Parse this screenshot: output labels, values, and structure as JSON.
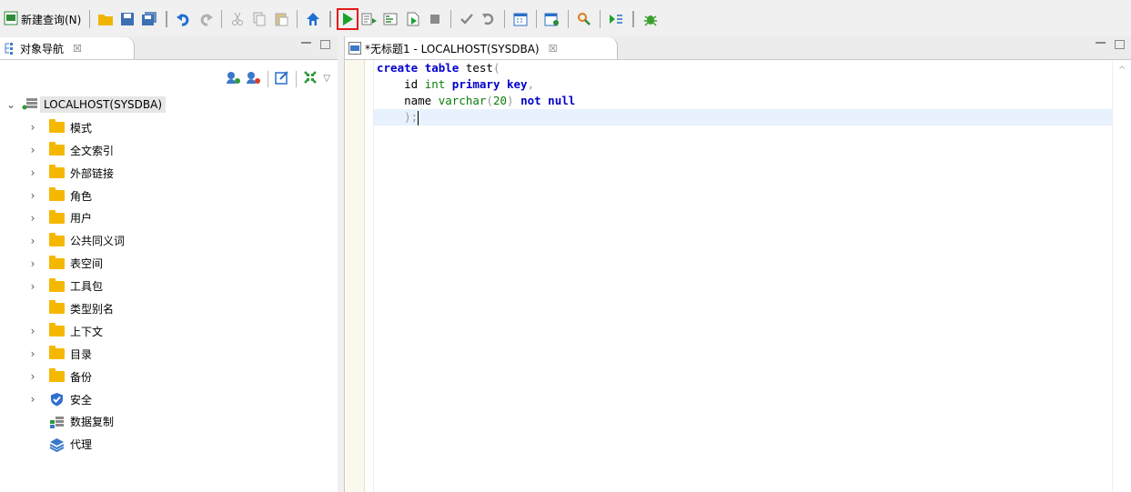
{
  "toolbar": {
    "new_query_label": "新建查询(N)"
  },
  "left_panel": {
    "tab_title": "对象导航",
    "tab_close": "☒",
    "tree": {
      "root": "LOCALHOST(SYSDBA)",
      "children": [
        {
          "label": "模式",
          "icon": "folder-icon",
          "expandable": true
        },
        {
          "label": "全文索引",
          "icon": "folder-icon",
          "expandable": true
        },
        {
          "label": "外部链接",
          "icon": "folder-icon",
          "expandable": true
        },
        {
          "label": "角色",
          "icon": "folder-icon",
          "expandable": true
        },
        {
          "label": "用户",
          "icon": "folder-icon",
          "expandable": true
        },
        {
          "label": "公共同义词",
          "icon": "folder-icon",
          "expandable": true
        },
        {
          "label": "表空间",
          "icon": "folder-icon",
          "expandable": true
        },
        {
          "label": "工具包",
          "icon": "folder-icon",
          "expandable": true
        },
        {
          "label": "类型别名",
          "icon": "folder-icon",
          "expandable": false
        },
        {
          "label": "上下文",
          "icon": "folder-icon",
          "expandable": true
        },
        {
          "label": "目录",
          "icon": "folder-icon",
          "expandable": true
        },
        {
          "label": "备份",
          "icon": "folder-icon",
          "expandable": true
        },
        {
          "label": "安全",
          "icon": "shield-icon",
          "expandable": true
        },
        {
          "label": "数据复制",
          "icon": "replication-icon",
          "expandable": false
        },
        {
          "label": "代理",
          "icon": "layers-icon",
          "expandable": false
        }
      ]
    }
  },
  "editor": {
    "tab_title": "*无标题1 - LOCALHOST(SYSDBA)",
    "tab_close": "☒",
    "code_lines": [
      [
        "create",
        " ",
        "table",
        " test",
        "("
      ],
      [
        "    id ",
        "int",
        " ",
        "primary key",
        ","
      ],
      [
        "    name ",
        "varchar",
        "(",
        "20",
        ")",
        " ",
        "not null"
      ],
      [
        "    ",
        ");"
      ]
    ]
  },
  "colors": {
    "keyword": "#0000cc",
    "type": "#0a7d0a",
    "current_line": "#e8f2fe",
    "highlight_box": "#e51a1a",
    "folder": "#f5b800"
  }
}
